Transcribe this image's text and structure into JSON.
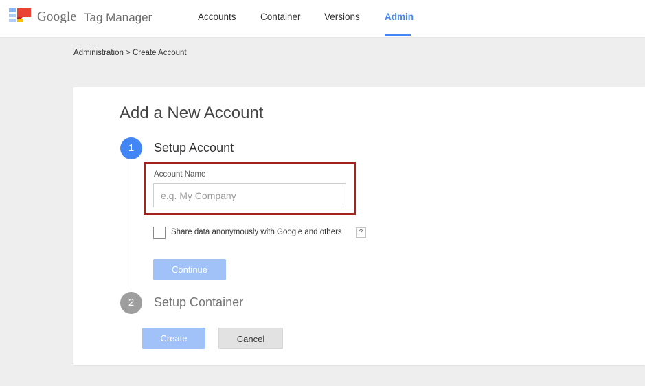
{
  "app": {
    "brand_google": "Google",
    "brand_product": "Tag Manager"
  },
  "nav": {
    "items": [
      {
        "label": "Accounts"
      },
      {
        "label": "Container"
      },
      {
        "label": "Versions"
      },
      {
        "label": "Admin",
        "active": true
      }
    ]
  },
  "breadcrumb": "Administration > Create Account",
  "page": {
    "title": "Add a New Account",
    "steps": [
      {
        "number": "1",
        "title": "Setup Account",
        "state": "active"
      },
      {
        "number": "2",
        "title": "Setup Container",
        "state": "inactive"
      }
    ],
    "account_name": {
      "label": "Account Name",
      "value": "",
      "placeholder": "e.g. My Company"
    },
    "share_data": {
      "label": "Share data anonymously with Google and others",
      "checked": false,
      "help": "?"
    },
    "continue_label": "Continue",
    "create_label": "Create",
    "cancel_label": "Cancel"
  },
  "colors": {
    "accent": "#4285f4",
    "highlight": "#a5231d",
    "button_disabled": "#a0c2f8",
    "step_inactive": "#9e9e9e"
  },
  "icons": {
    "logo": "tag-manager-logo-icon",
    "help": "help-icon"
  }
}
